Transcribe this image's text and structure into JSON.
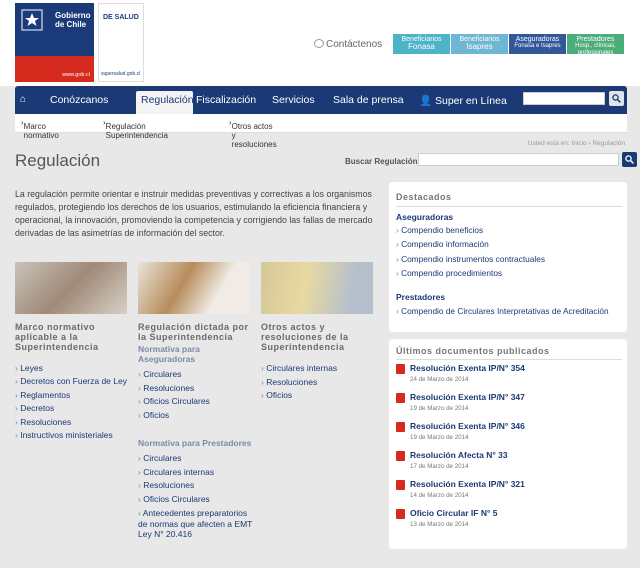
{
  "header": {
    "gob_logo_text": "Gobierno de Chile",
    "gob_logo_url": "www.gob.cl",
    "sup_logo_text": "DE SALUD",
    "sup_logo_url": "supersalud.gob.cl",
    "contact": "Contáctenos",
    "quick": [
      {
        "top": "Beneficiarios",
        "bottom": "Fonasa",
        "color": "#4db3c9"
      },
      {
        "top": "Beneficiarios",
        "bottom": "Isapres",
        "color": "#6fb6d4"
      },
      {
        "top": "Aseguradoras",
        "bottom": "Fonasa e Isapres",
        "color": "#32589a"
      },
      {
        "top": "Prestadores",
        "bottom": "Hosp., clínicas, profesionales",
        "color": "#4dad7a"
      }
    ]
  },
  "nav": {
    "items": [
      "Conózcanos",
      "Regulación",
      "Fiscalización",
      "Servicios",
      "Sala de prensa",
      "Super en Línea"
    ],
    "active": "Regulación"
  },
  "subnav": [
    "Marco normativo",
    "Regulación Superintendencia",
    "Otros actos y resoluciones"
  ],
  "breadcrumb": {
    "label": "Usted está en:",
    "home": "Inicio",
    "current": "Regulación"
  },
  "page": {
    "title": "Regulación",
    "search_label": "Buscar Regulación",
    "intro": "La regulación permite orientar e instruir medidas preventivas y correctivas a los organismos regulados, protegiendo los derechos de los usuarios, estimulando la eficiencia financiera y operacional, la innovación, promoviendo la competencia y corrigiendo las fallas de mercado derivadas de las asimetrías de información del sector."
  },
  "columns": [
    {
      "title": "Marco normativo aplicable a la Superintendencia",
      "items": [
        "Leyes",
        "Decretos con Fuerza de Ley",
        "Reglamentos",
        "Decretos",
        "Resoluciones",
        "Instructivos ministeriales"
      ]
    },
    {
      "title": "Regulación dictada por la Superintendencia",
      "groups": [
        {
          "heading": "Normativa para Aseguradoras",
          "items": [
            "Circulares",
            "Resoluciones",
            "Oficios Circulares",
            "Oficios"
          ]
        },
        {
          "heading": "Normativa para Prestadores",
          "items": [
            "Circulares",
            "Circulares internas",
            "Resoluciones",
            "Oficios Circulares",
            "Antecedentes preparatorios de normas que afecten a EMT Ley N° 20.416"
          ]
        }
      ]
    },
    {
      "title": "Otros actos y resoluciones de la Superintendencia",
      "items": [
        "Circulares internas",
        "Resoluciones",
        "Oficios"
      ]
    }
  ],
  "destacados": {
    "title": "Destacados",
    "aseguradoras": {
      "heading": "Aseguradoras",
      "items": [
        "Compendio beneficios",
        "Compendio información",
        "Compendio instrumentos contractuales",
        "Compendio procedimientos"
      ]
    },
    "prestadores": {
      "heading": "Prestadores",
      "items": [
        "Compendio de Circulares Interpretativas de Acreditación"
      ]
    }
  },
  "ultimos": {
    "title": "Últimos documentos publicados",
    "docs": [
      {
        "name": "Resolución Exenta IP/N° 354",
        "date": "24 de Marzo de 2014"
      },
      {
        "name": "Resolución Exenta IP/N° 347",
        "date": "19 de Marzo de 2014"
      },
      {
        "name": "Resolución Exenta IP/N° 346",
        "date": "19 de Marzo de 2014"
      },
      {
        "name": "Resolución Afecta N° 33",
        "date": "17 de Marzo de 2014"
      },
      {
        "name": "Resolución Exenta IP/N° 321",
        "date": "14 de Marzo de 2014"
      },
      {
        "name": "Oficio Circular IF N° 5",
        "date": "13 de Marzo de 2014"
      }
    ]
  }
}
